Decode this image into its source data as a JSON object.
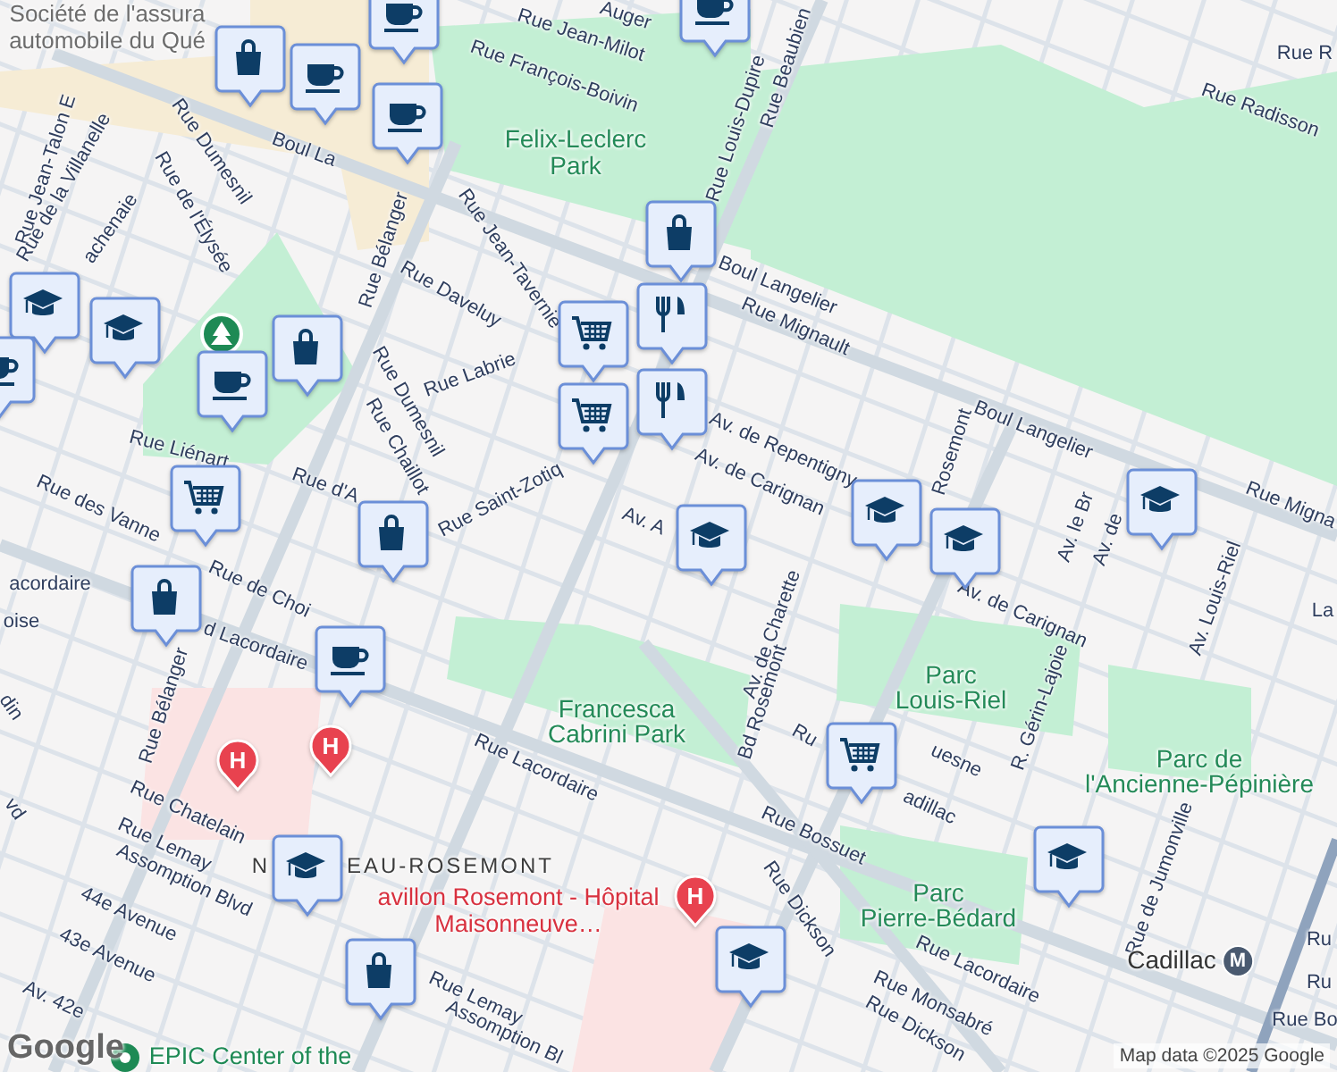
{
  "map": {
    "labels": [
      {
        "text": "Société de l'assura",
        "kind": "place"
      },
      {
        "text": "automobile du Qué",
        "kind": "place"
      },
      {
        "text": "Auger",
        "kind": "street"
      },
      {
        "text": "Rue Jean-Milot",
        "kind": "street"
      },
      {
        "text": "Rue François-Boivin",
        "kind": "street"
      },
      {
        "text": "Rue Louis-Dupire",
        "kind": "street"
      },
      {
        "text": "Rue Beaubien",
        "kind": "street"
      },
      {
        "text": "Rue Radisson",
        "kind": "street"
      },
      {
        "text": "Rue R",
        "kind": "street"
      },
      {
        "text": "Boul La",
        "kind": "street"
      },
      {
        "text": "Felix-Leclerc",
        "kind": "park"
      },
      {
        "text": "Park",
        "kind": "park"
      },
      {
        "text": "Rue Jean-Talon E",
        "kind": "street"
      },
      {
        "text": "Rue Dumesnil",
        "kind": "street"
      },
      {
        "text": "Rue de la Villanelle",
        "kind": "street"
      },
      {
        "text": "achenaie",
        "kind": "street"
      },
      {
        "text": "Rue de l'Élysée",
        "kind": "street"
      },
      {
        "text": "Rue Bélanger",
        "kind": "street"
      },
      {
        "text": "Rue Daveluy",
        "kind": "street"
      },
      {
        "text": "Rue Jean-Tavernie",
        "kind": "street"
      },
      {
        "text": "Rue Labrie",
        "kind": "street"
      },
      {
        "text": "Rue Dumesnil",
        "kind": "street"
      },
      {
        "text": "Rue Chaillot",
        "kind": "street"
      },
      {
        "text": "Rue Saint-Zotiq",
        "kind": "street"
      },
      {
        "text": "Rue Liénart",
        "kind": "street"
      },
      {
        "text": "Rue d'A",
        "kind": "street"
      },
      {
        "text": "Rue des Vanne",
        "kind": "street"
      },
      {
        "text": "Rue Mignault",
        "kind": "street"
      },
      {
        "text": "Boul Langelier",
        "kind": "street"
      },
      {
        "text": "Boul Langelier",
        "kind": "street"
      },
      {
        "text": "Rue Migna",
        "kind": "street"
      },
      {
        "text": "Av. de Repentigny",
        "kind": "street"
      },
      {
        "text": "Av. de Carignan",
        "kind": "street"
      },
      {
        "text": "Rosemont",
        "kind": "street"
      },
      {
        "text": "Av. A",
        "kind": "street"
      },
      {
        "text": "Av. de Carignan",
        "kind": "street"
      },
      {
        "text": "Av. de Charette",
        "kind": "street"
      },
      {
        "text": "Av. le Br",
        "kind": "street"
      },
      {
        "text": "Av. de",
        "kind": "street"
      },
      {
        "text": "Av. Louis-Riel",
        "kind": "street"
      },
      {
        "text": "La",
        "kind": "street"
      },
      {
        "text": "acordaire",
        "kind": "street"
      },
      {
        "text": "oise",
        "kind": "street"
      },
      {
        "text": "Rue de Choi",
        "kind": "street"
      },
      {
        "text": "d Lacordaire",
        "kind": "street"
      },
      {
        "text": "Rue Bélanger",
        "kind": "street"
      },
      {
        "text": "din",
        "kind": "street"
      },
      {
        "text": "vd",
        "kind": "street"
      },
      {
        "text": "Francesca",
        "kind": "park"
      },
      {
        "text": "Cabrini Park",
        "kind": "park"
      },
      {
        "text": "Rue Lacordaire",
        "kind": "street"
      },
      {
        "text": "Rue Chatelain",
        "kind": "street"
      },
      {
        "text": "Rue Lemay",
        "kind": "street"
      },
      {
        "text": "Assomption Blvd",
        "kind": "street"
      },
      {
        "text": "44e Avenue",
        "kind": "street"
      },
      {
        "text": "43e Avenue",
        "kind": "street"
      },
      {
        "text": "Av. 42e",
        "kind": "street"
      },
      {
        "text": "N",
        "kind": "district"
      },
      {
        "text": "EAU-ROSEMONT",
        "kind": "district"
      },
      {
        "text": "avillon Rosemont - Hôpital",
        "kind": "hospital"
      },
      {
        "text": "Maisonneuve…",
        "kind": "hospital"
      },
      {
        "text": "Rue Lemay",
        "kind": "street"
      },
      {
        "text": "Assomption Bl",
        "kind": "street"
      },
      {
        "text": "Bd Rosemont",
        "kind": "street"
      },
      {
        "text": "Parc",
        "kind": "park"
      },
      {
        "text": "Louis-Riel",
        "kind": "park"
      },
      {
        "text": "Ru",
        "kind": "street"
      },
      {
        "text": "uesne",
        "kind": "street"
      },
      {
        "text": "adillac",
        "kind": "street"
      },
      {
        "text": "Rue Bossuet",
        "kind": "street"
      },
      {
        "text": "R. Gérin-Lajoie",
        "kind": "street"
      },
      {
        "text": "Parc de",
        "kind": "park"
      },
      {
        "text": "l'Ancienne-Pépinière",
        "kind": "park"
      },
      {
        "text": "Parc",
        "kind": "park"
      },
      {
        "text": "Pierre-Bédard",
        "kind": "park"
      },
      {
        "text": "Rue de Jumonville",
        "kind": "street"
      },
      {
        "text": "Rue Dickson",
        "kind": "street"
      },
      {
        "text": "Rue Lacordaire",
        "kind": "street"
      },
      {
        "text": "Rue Monsabré",
        "kind": "street"
      },
      {
        "text": "Rue Dickson",
        "kind": "street"
      },
      {
        "text": "Ru",
        "kind": "street"
      },
      {
        "text": "Ru",
        "kind": "street"
      },
      {
        "text": "Rue Bo",
        "kind": "street"
      },
      {
        "text": "Cadillac",
        "kind": "metro",
        "badge": "M"
      },
      {
        "text": "EPIC Center of the",
        "kind": "venue"
      }
    ],
    "markers": [
      {
        "kind": "cafe"
      },
      {
        "kind": "shop"
      },
      {
        "kind": "cafe"
      },
      {
        "kind": "cafe"
      },
      {
        "kind": "school"
      },
      {
        "kind": "school"
      },
      {
        "kind": "cafe"
      },
      {
        "kind": "shop"
      },
      {
        "kind": "cafe"
      },
      {
        "kind": "shop"
      },
      {
        "kind": "restaurant"
      },
      {
        "kind": "grocery"
      },
      {
        "kind": "restaurant"
      },
      {
        "kind": "grocery"
      },
      {
        "kind": "grocery"
      },
      {
        "kind": "shop"
      },
      {
        "kind": "shop"
      },
      {
        "kind": "cafe"
      },
      {
        "kind": "school"
      },
      {
        "kind": "school"
      },
      {
        "kind": "school"
      },
      {
        "kind": "school"
      },
      {
        "kind": "grocery"
      },
      {
        "kind": "school"
      },
      {
        "kind": "school"
      },
      {
        "kind": "shop"
      },
      {
        "kind": "school"
      },
      {
        "kind": "cafe"
      },
      {
        "kind": "hospital",
        "label": "H"
      },
      {
        "kind": "hospital",
        "label": "H"
      },
      {
        "kind": "hospital",
        "label": "H"
      }
    ],
    "logo": "Google",
    "attribution": "Map data ©2025 Google"
  }
}
